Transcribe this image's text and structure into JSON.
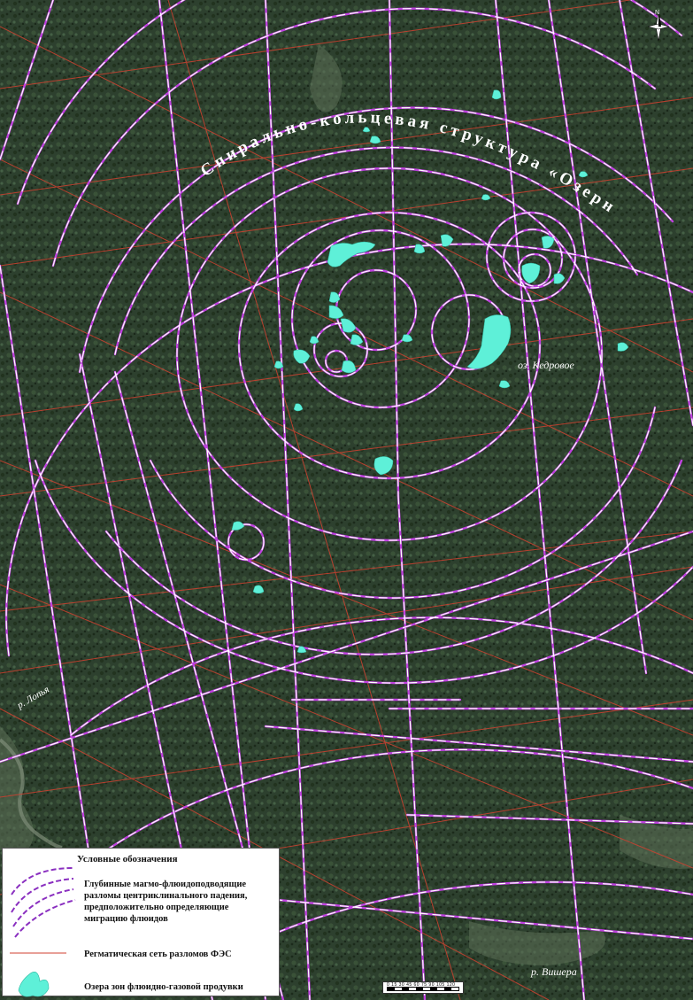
{
  "map": {
    "title": "Спирально-кольцевая структура «Озерная»",
    "labels": {
      "lake": "оз. Кедровое",
      "river_lopya": "р. Лопья",
      "river_vishera": "р. Вишера"
    },
    "compass_letter": "N",
    "scale_labels": "0 15 30 45 60 75 90 105 120",
    "colors": {
      "forest": "#2d402e",
      "fault_magma": "#c040e0",
      "fault_regmatic": "#d04030",
      "lake_fill": "#5ef0d8"
    }
  },
  "legend": {
    "title": "Условные обозначения",
    "items": [
      {
        "symbol": "magma-fault-arcs-icon",
        "text": "Глубинные магмо-флюидоподводящие\nразломы центриклинального падения,\nпредположительно определяющие\nмиграцию флюидов"
      },
      {
        "symbol": "red-line-icon",
        "text": "Регматическая сеть разломов ФЭС"
      },
      {
        "symbol": "lake-shape-icon",
        "text": "Озера зон флюидно-газовой продувки"
      }
    ]
  }
}
